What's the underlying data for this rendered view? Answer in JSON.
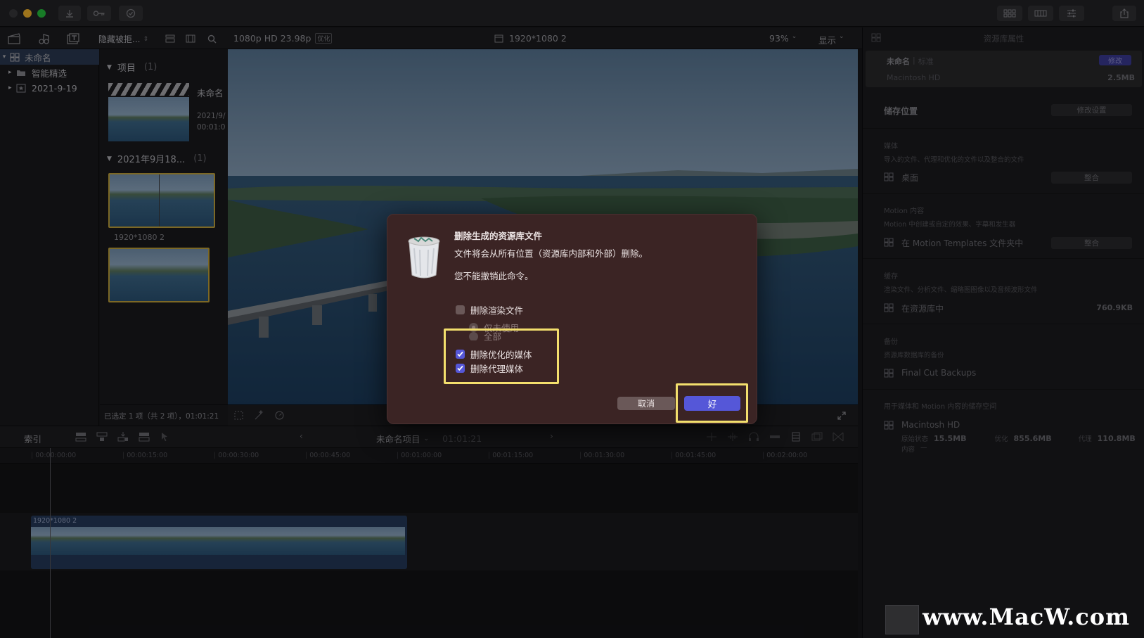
{
  "window": {
    "traffic_lights": [
      "#ff5f57",
      "#febc2e",
      "#28c840"
    ]
  },
  "toolbar": {
    "hide_rejected": "隐藏被拒...",
    "format": "1080p HD 23.98p",
    "optimize_badge": "优化",
    "clip_name": "1920*1080 2",
    "zoom": "93%",
    "display": "显示"
  },
  "sidebar": {
    "items": [
      {
        "label": "未命名",
        "icon": "library-icon"
      },
      {
        "label": "智能精选",
        "icon": "folder-icon"
      },
      {
        "label": "2021-9-19",
        "icon": "event-star-icon"
      }
    ]
  },
  "browser": {
    "section1": {
      "title": "项目",
      "count": "(1)"
    },
    "project": {
      "name": "未命名",
      "date": "2021/9/",
      "duration": "00:01:0"
    },
    "section2": {
      "title": "2021年9月18...",
      "count": "(1)"
    },
    "clip_label": "1920*1080 2",
    "status": "已选定 1 项（共 2 项），01:01:21"
  },
  "inspector": {
    "title": "资源库属性",
    "library_name": "未命名",
    "library_type": "标准",
    "modify": "修改",
    "disk": "Macintosh HD",
    "size": "2.5MB",
    "storage_location": "储存位置",
    "modify_settings": "修改设置",
    "media": {
      "title": "媒体",
      "desc": "导入的文件、代理和优化的文件以及整合的文件",
      "value": "桌面",
      "button": "整合"
    },
    "motion": {
      "title": "Motion 内容",
      "desc": "Motion 中创建或自定的效果、字幕和发生器",
      "value": "在 Motion Templates 文件夹中",
      "button": "整合"
    },
    "cache": {
      "title": "缓存",
      "desc": "渲染文件、分析文件、缩略图图像以及音频波形文件",
      "value": "在资源库中",
      "size": "760.9KB"
    },
    "backup": {
      "title": "备份",
      "desc": "资源库数据库的备份",
      "value": "Final Cut Backups"
    },
    "storage_space": {
      "title": "用于媒体和 Motion 内容的储存空间",
      "disk": "Macintosh HD",
      "original_label": "原始状态",
      "original": "15.5MB",
      "optimized_label": "优化",
      "optimized": "855.6MB",
      "proxy_label": "代理",
      "proxy": "110.8MB",
      "content_label": "内容",
      "content": "—"
    }
  },
  "timeline": {
    "index": "索引",
    "project": "未命名项目",
    "timecode": "01:01:21",
    "ruler": [
      "00:00:00:00",
      "00:00:15:00",
      "00:00:30:00",
      "00:00:45:00",
      "00:01:00:00",
      "00:01:15:00",
      "00:01:30:00",
      "00:01:45:00",
      "00:02:00:00"
    ],
    "clip_label": "1920*1080 2"
  },
  "dialog": {
    "title": "删除生成的资源库文件",
    "message": "文件将会从所有位置（资源库内部和外部）删除。",
    "warning": "您不能撤销此命令。",
    "delete_render": {
      "label": "删除渲染文件",
      "checked": false
    },
    "radio_unused": "仅未使用",
    "radio_all": "全部",
    "delete_optimized": {
      "label": "删除优化的媒体",
      "checked": true
    },
    "delete_proxy": {
      "label": "删除代理媒体",
      "checked": true
    },
    "cancel": "取消",
    "ok": "好",
    "highlight_color": "#f3df6d",
    "accent": "#5557d8"
  },
  "watermark": "www.MacW.com"
}
